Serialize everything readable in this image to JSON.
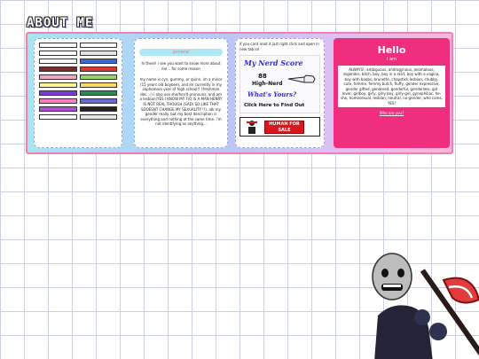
{
  "page": {
    "title": "ABOUT ME"
  },
  "stamps": {
    "items": [
      "",
      "",
      "",
      "",
      "",
      "",
      "",
      "",
      "",
      "",
      "",
      "",
      "",
      "",
      "",
      "",
      "",
      "",
      "",
      "",
      ""
    ]
  },
  "bio": {
    "title": "general",
    "intro": "hi there! i see you want to know more about me... for some reason",
    "text": "my name is cyn, gummy, or quinn. im a minor (15 years old boybee), and im currently in my sophomore year of high school!! (freshman dec. ☝︎) i also use she/her/it pronouns, and am a lesbian(YES I KNOW MY F/O IS A MAN HENRY IS NOT REAL THOUGH (SAD) SO LIKE THAT SDOESNT CHANGE MY SEXUALITY !!). idk my gender really. but my best description is everything and nothing at the same time. i'm not identifying as anything..."
  },
  "nerd": {
    "note": "if you cant read it just right click and open in new tab lol",
    "ad_title": "My Nerd Score",
    "score": "88",
    "rank": "High-Nerd",
    "whats": "What's Yours?",
    "click": "Click Here to Find Out",
    "sale_text": "HUMAN FOR SALE"
  },
  "hello": {
    "title": "Hello",
    "subtitle": "I am",
    "body": "ALWAYS!, ambiguous, androgynous, anomalous, bigender, bitch, boy, boy in a skirt, boy with a vagina, boy with boobs, brunette, chapstick lesbian, chubby, cute, femme, femmy butch, fluffy, gender expressive, gender gifted, gendered, genderful, genderless, girl lover, girlboy, girly, girly boy, girly-girl, gynephiliac, he-she, homosexual, lesbian, neutral, no-gender, who cares, YES!",
    "link": "Who are you?"
  },
  "colors": {
    "accent": "#ef2f7e",
    "panel_border": "#f07fb4"
  }
}
